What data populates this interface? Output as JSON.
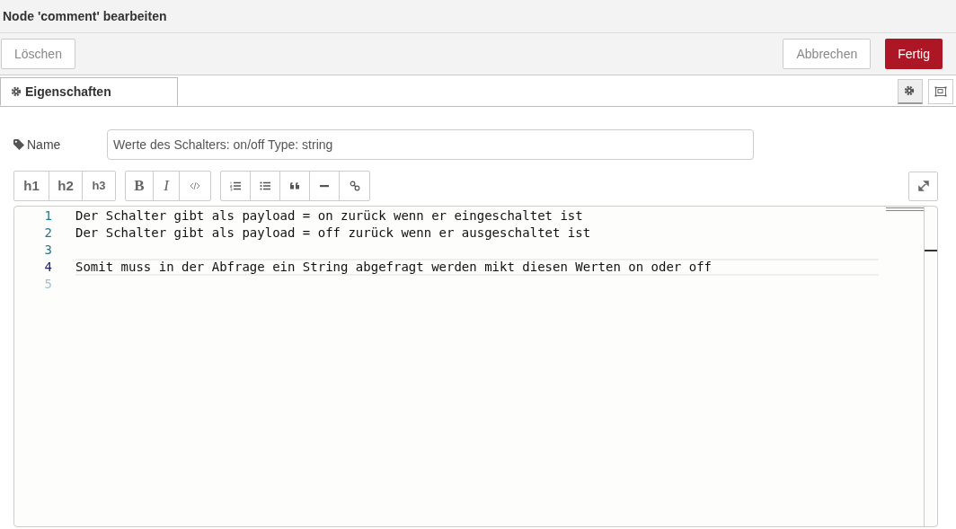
{
  "window": {
    "title": "Node 'comment' bearbeiten"
  },
  "actions": {
    "delete": "Löschen",
    "cancel": "Abbrechen",
    "done": "Fertig"
  },
  "tabs": [
    {
      "label": "Eigenschaften",
      "selected": true
    }
  ],
  "side_tabs": [
    {
      "kind": "settings",
      "selected": true
    },
    {
      "kind": "frame",
      "selected": false
    }
  ],
  "name_field": {
    "label": "Name",
    "value": "Werte des Schalters: on/off Type: string"
  },
  "toolbar": [
    {
      "buttons": [
        {
          "kind": "h1",
          "label": "h1"
        },
        {
          "kind": "h2",
          "label": "h2"
        },
        {
          "kind": "h3",
          "label": "h3"
        }
      ]
    },
    {
      "buttons": [
        {
          "kind": "bold",
          "label": "B"
        },
        {
          "kind": "italic",
          "label": "I"
        },
        {
          "kind": "code"
        }
      ]
    },
    {
      "buttons": [
        {
          "kind": "ordered-list"
        },
        {
          "kind": "bullet-list"
        },
        {
          "kind": "quote"
        },
        {
          "kind": "rule"
        },
        {
          "kind": "link"
        }
      ]
    }
  ],
  "editor": {
    "lines": [
      {
        "number": "1",
        "text": "Der Schalter gibt als payload = on zurück wenn er eingeschaltet ist",
        "current": false
      },
      {
        "number": "2",
        "text": "Der Schalter gibt als payload = off zurück wenn er ausgeschaltet ist",
        "current": false
      },
      {
        "number": "3",
        "current": false
      },
      {
        "number": "4",
        "text": "Somit muss in der Abfrage ein String abgefragt werden mikt diesen Werten on oder off",
        "current": true
      },
      {
        "number": "5",
        "current": false
      }
    ]
  }
}
